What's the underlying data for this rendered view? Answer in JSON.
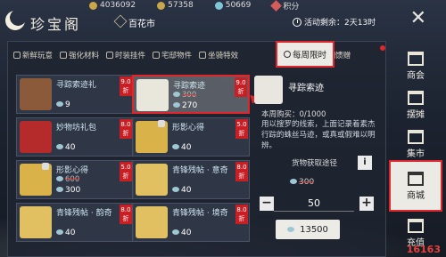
{
  "currency": [
    {
      "icon": "gold-coin-icon",
      "value": "4036092"
    },
    {
      "icon": "silver-coin-icon",
      "value": "57358"
    },
    {
      "icon": "jade-icon",
      "value": "50669"
    },
    {
      "icon": "points-icon",
      "value": "积分"
    }
  ],
  "header": {
    "title": "珍宝阁",
    "city": "百花市",
    "timer_label": "活动剩余：2天13时",
    "close_label": "✕"
  },
  "tabs": [
    {
      "label": "新鲜玩意",
      "icon": "new-icon"
    },
    {
      "label": "强化材料",
      "icon": "enhance-icon"
    },
    {
      "label": "时装挂件",
      "icon": "fashion-icon"
    },
    {
      "label": "宅邸物件",
      "icon": "house-icon"
    },
    {
      "label": "坐骑特效",
      "icon": "mount-icon"
    },
    {
      "label": "每周限时",
      "icon": "timer-icon",
      "active": true
    },
    {
      "label": "江湖馈赠",
      "icon": "gift-icon"
    }
  ],
  "items": [
    {
      "name": "寻踪索迹礼",
      "old_price": "",
      "price": "9",
      "discount": [
        "9.0",
        "折"
      ],
      "thumb": "#8a5a3a",
      "locked": false
    },
    {
      "name": "寻踪索迹",
      "old_price": "300",
      "price": "270",
      "discount": [
        "9.0",
        "折"
      ],
      "thumb": "#e9e6dc",
      "locked": false,
      "selected": true
    },
    {
      "name": "妙物坊礼包",
      "old_price": "",
      "price": "40",
      "discount": [
        "8.0",
        "折"
      ],
      "thumb": "#b52a2a",
      "locked": false
    },
    {
      "name": "形影心得",
      "old_price": "",
      "price": "40",
      "discount": [
        "5.0",
        "折"
      ],
      "thumb": "#d9b24a",
      "locked": true
    },
    {
      "name": "形影心得",
      "old_price": "600",
      "price": "300",
      "discount": [
        "5.0",
        "折"
      ],
      "thumb": "#d9b24a",
      "locked": true
    },
    {
      "name": "青锋残帖 · 意奇",
      "old_price": "",
      "price": "40",
      "discount": [
        "8.0",
        "折"
      ],
      "thumb": "#e0c060",
      "locked": false
    },
    {
      "name": "青锋残帖 · 韵奇",
      "old_price": "",
      "price": "40",
      "discount": [
        "8.0",
        "折"
      ],
      "thumb": "#e0c060",
      "locked": false
    },
    {
      "name": "青锋残帖 · 境奇",
      "old_price": "",
      "price": "40",
      "discount": [
        "8.0",
        "折"
      ],
      "thumb": "#e0c060",
      "locked": false
    }
  ],
  "detail": {
    "name": "寻踪索迹",
    "weekly": "本周购买：0/1000",
    "desc": "用以搜罗的线索，上面记录着素杰行踪的蛛丝马迹，或真或假难以明辨。",
    "source_label": "货物获取途径",
    "info_label": "i",
    "orig_price": "300",
    "minus": "−",
    "plus": "+",
    "quantity": "50",
    "total": "13500"
  },
  "sidebar": [
    {
      "label": "商会",
      "icon": "guild-icon"
    },
    {
      "label": "摆摊",
      "icon": "stall-icon"
    },
    {
      "label": "集市",
      "icon": "market-icon"
    },
    {
      "label": "商城",
      "icon": "mall-icon",
      "active": true
    },
    {
      "label": "充值",
      "icon": "recharge-icon"
    }
  ],
  "watermark": "16163"
}
